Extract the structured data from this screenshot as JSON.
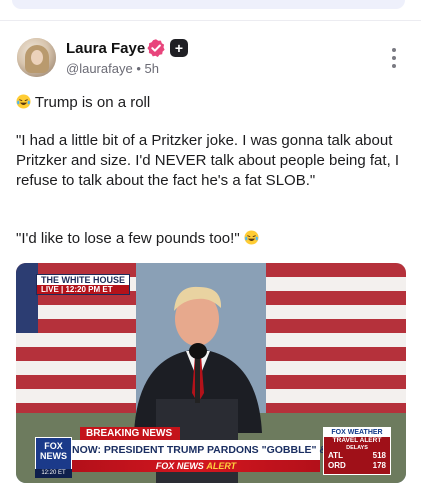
{
  "post": {
    "author_name": "Laura Faye",
    "author_handle": "@laurafaye",
    "separator": "•",
    "time_ago": "5h",
    "plus_badge": "+",
    "line1": "Trump is on a roll",
    "line2": "\"I had a little bit of a Pritzker joke. I was gonna talk about Pritzker and size. I'd NEVER talk about people being fat, I refuse to talk about the fact he's a fat SLOB.\"",
    "line3": "\"I'd like to lose a few pounds too!\""
  },
  "icons": {
    "verified": "verified-check-icon",
    "plus": "plus-badge-icon",
    "more": "more-vertical-icon",
    "emoji": "laughing-tears-emoji"
  },
  "video": {
    "wh_label": "THE WHITE HOUSE",
    "live_label": "LIVE | 12:20 PM ET",
    "breaking_label": "BREAKING NEWS",
    "headline": "NOW: PRESIDENT TRUMP PARDONS \"GOBBLE\" & \"WADDLE\"",
    "alert_brand": "FOX NEWS",
    "alert_word": "ALERT",
    "fox_logo_top": "FOX",
    "fox_logo_bottom": "NEWS",
    "fox_time": "12:20 ET",
    "weather_brand": "FOX WEATHER",
    "weather_alert": "TRAVEL ALERT",
    "weather_sub": "DELAYS",
    "city1": "ATL",
    "city1_value": "518",
    "city2": "ORD",
    "city2_value": "178"
  },
  "colors": {
    "verified_pink": "#e8457c",
    "fox_blue": "#1b3a8a",
    "breaking_red": "#c4131a"
  }
}
